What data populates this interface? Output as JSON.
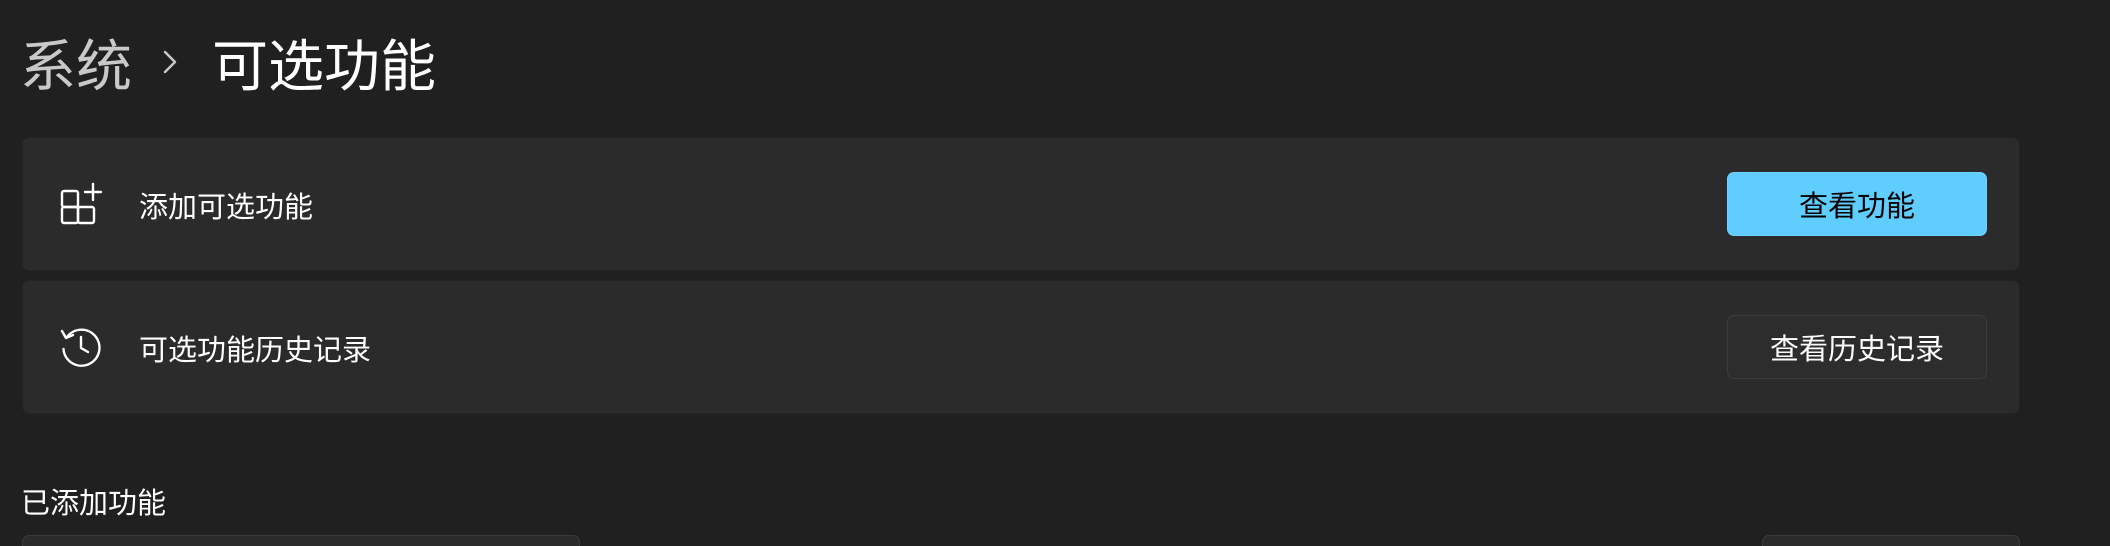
{
  "breadcrumb": {
    "parent": "系统",
    "separator_icon": "chevron-right-icon",
    "current": "可选功能"
  },
  "cards": {
    "add": {
      "icon": "add-apps-icon",
      "label": "添加可选功能",
      "button_label": "查看功能"
    },
    "history": {
      "icon": "history-icon",
      "label": "可选功能历史记录",
      "button_label": "查看历史记录"
    }
  },
  "installed_section": {
    "title": "已添加功能"
  },
  "colors": {
    "background": "#202020",
    "card": "#2b2b2b",
    "accent": "#60cdff"
  }
}
